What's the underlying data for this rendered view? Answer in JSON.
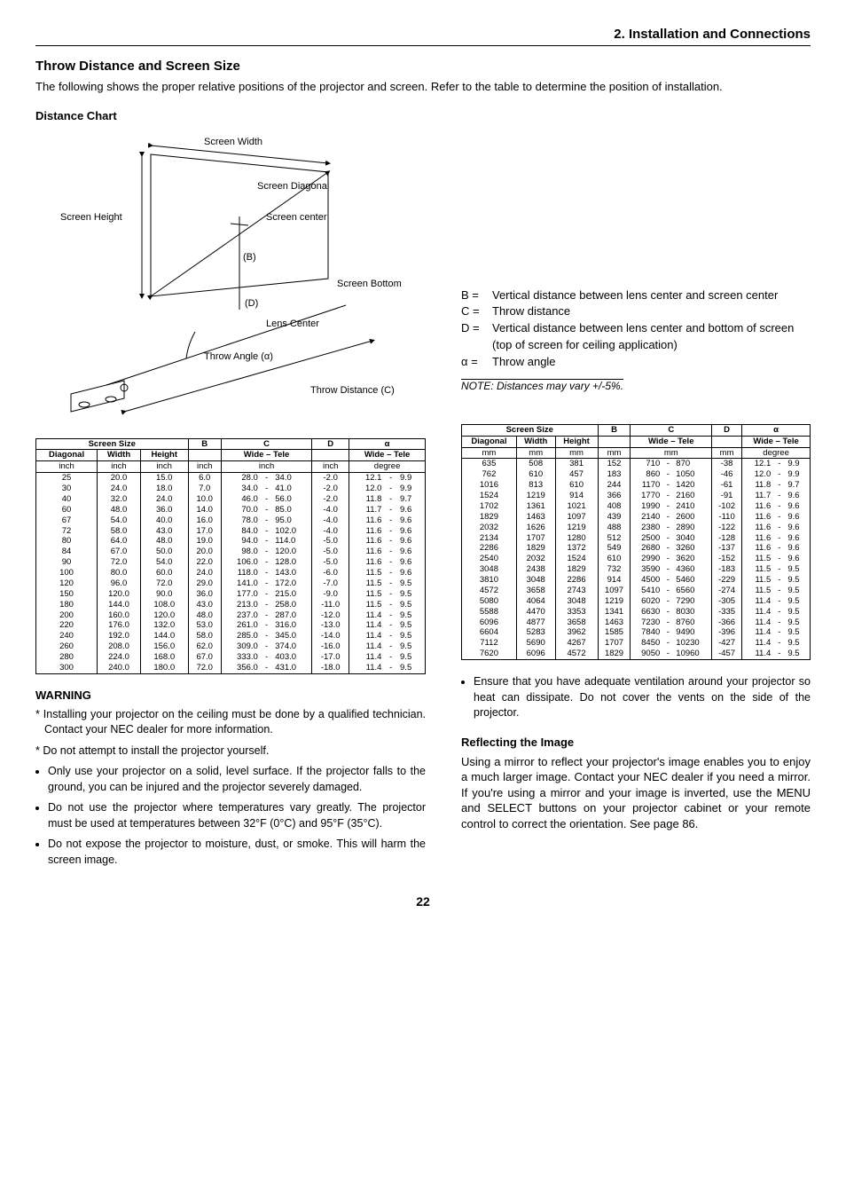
{
  "section_header": "2. Installation and Connections",
  "title": "Throw Distance and Screen Size",
  "intro": "The following shows the proper relative positions of the projector and screen. Refer to the table to determine the position of installation.",
  "distance_chart_title": "Distance Chart",
  "diagram": {
    "screen_width": "Screen Width",
    "screen_height": "Screen Height",
    "screen_diagonal": "Screen Diagonal",
    "screen_center": "Screen center",
    "screen_bottom": "Screen Bottom",
    "lens_center": "Lens Center",
    "throw_angle": "Throw Angle (α)",
    "throw_distance": "Throw Distance (C)",
    "b": "(B)",
    "d": "(D)"
  },
  "definitions": {
    "b_key": "B =",
    "b_val": "Vertical distance between lens center and screen center",
    "c_key": "C =",
    "c_val": "Throw distance",
    "d_key": "D =",
    "d_val": "Vertical distance between lens center and bottom of screen (top of screen for ceiling application)",
    "alpha_key": "α =",
    "alpha_val": "Throw angle"
  },
  "note": "NOTE: Distances may vary +/-5%.",
  "table_inch": {
    "headers": {
      "ss": "Screen Size",
      "diag": "Diagonal",
      "w": "Width",
      "h": "Height",
      "b": "B",
      "c": "C",
      "wt": "Wide – Tele",
      "d": "D",
      "a": "α"
    },
    "unit": "inch",
    "unit_deg": "degree",
    "rows": [
      [
        "25",
        "20.0",
        "15.0",
        "6.0",
        "28.0",
        "-",
        "34.0",
        "-2.0",
        "12.1",
        "-",
        "9.9"
      ],
      [
        "30",
        "24.0",
        "18.0",
        "7.0",
        "34.0",
        "-",
        "41.0",
        "-2.0",
        "12.0",
        "-",
        "9.9"
      ],
      [
        "40",
        "32.0",
        "24.0",
        "10.0",
        "46.0",
        "-",
        "56.0",
        "-2.0",
        "11.8",
        "-",
        "9.7"
      ],
      [
        "60",
        "48.0",
        "36.0",
        "14.0",
        "70.0",
        "-",
        "85.0",
        "-4.0",
        "11.7",
        "-",
        "9.6"
      ],
      [
        "67",
        "54.0",
        "40.0",
        "16.0",
        "78.0",
        "-",
        "95.0",
        "-4.0",
        "11.6",
        "-",
        "9.6"
      ],
      [
        "72",
        "58.0",
        "43.0",
        "17.0",
        "84.0",
        "-",
        "102.0",
        "-4.0",
        "11.6",
        "-",
        "9.6"
      ],
      [
        "80",
        "64.0",
        "48.0",
        "19.0",
        "94.0",
        "-",
        "114.0",
        "-5.0",
        "11.6",
        "-",
        "9.6"
      ],
      [
        "84",
        "67.0",
        "50.0",
        "20.0",
        "98.0",
        "-",
        "120.0",
        "-5.0",
        "11.6",
        "-",
        "9.6"
      ],
      [
        "90",
        "72.0",
        "54.0",
        "22.0",
        "106.0",
        "-",
        "128.0",
        "-5.0",
        "11.6",
        "-",
        "9.6"
      ],
      [
        "100",
        "80.0",
        "60.0",
        "24.0",
        "118.0",
        "-",
        "143.0",
        "-6.0",
        "11.5",
        "-",
        "9.6"
      ],
      [
        "120",
        "96.0",
        "72.0",
        "29.0",
        "141.0",
        "-",
        "172.0",
        "-7.0",
        "11.5",
        "-",
        "9.5"
      ],
      [
        "150",
        "120.0",
        "90.0",
        "36.0",
        "177.0",
        "-",
        "215.0",
        "-9.0",
        "11.5",
        "-",
        "9.5"
      ],
      [
        "180",
        "144.0",
        "108.0",
        "43.0",
        "213.0",
        "-",
        "258.0",
        "-11.0",
        "11.5",
        "-",
        "9.5"
      ],
      [
        "200",
        "160.0",
        "120.0",
        "48.0",
        "237.0",
        "-",
        "287.0",
        "-12.0",
        "11.4",
        "-",
        "9.5"
      ],
      [
        "220",
        "176.0",
        "132.0",
        "53.0",
        "261.0",
        "-",
        "316.0",
        "-13.0",
        "11.4",
        "-",
        "9.5"
      ],
      [
        "240",
        "192.0",
        "144.0",
        "58.0",
        "285.0",
        "-",
        "345.0",
        "-14.0",
        "11.4",
        "-",
        "9.5"
      ],
      [
        "260",
        "208.0",
        "156.0",
        "62.0",
        "309.0",
        "-",
        "374.0",
        "-16.0",
        "11.4",
        "-",
        "9.5"
      ],
      [
        "280",
        "224.0",
        "168.0",
        "67.0",
        "333.0",
        "-",
        "403.0",
        "-17.0",
        "11.4",
        "-",
        "9.5"
      ],
      [
        "300",
        "240.0",
        "180.0",
        "72.0",
        "356.0",
        "-",
        "431.0",
        "-18.0",
        "11.4",
        "-",
        "9.5"
      ]
    ]
  },
  "table_mm": {
    "unit": "mm",
    "unit_deg": "degree",
    "rows": [
      [
        "635",
        "508",
        "381",
        "152",
        "710",
        "-",
        "870",
        "-38",
        "12.1",
        "-",
        "9.9"
      ],
      [
        "762",
        "610",
        "457",
        "183",
        "860",
        "-",
        "1050",
        "-46",
        "12.0",
        "-",
        "9.9"
      ],
      [
        "1016",
        "813",
        "610",
        "244",
        "1170",
        "-",
        "1420",
        "-61",
        "11.8",
        "-",
        "9.7"
      ],
      [
        "1524",
        "1219",
        "914",
        "366",
        "1770",
        "-",
        "2160",
        "-91",
        "11.7",
        "-",
        "9.6"
      ],
      [
        "1702",
        "1361",
        "1021",
        "408",
        "1990",
        "-",
        "2410",
        "-102",
        "11.6",
        "-",
        "9.6"
      ],
      [
        "1829",
        "1463",
        "1097",
        "439",
        "2140",
        "-",
        "2600",
        "-110",
        "11.6",
        "-",
        "9.6"
      ],
      [
        "2032",
        "1626",
        "1219",
        "488",
        "2380",
        "-",
        "2890",
        "-122",
        "11.6",
        "-",
        "9.6"
      ],
      [
        "2134",
        "1707",
        "1280",
        "512",
        "2500",
        "-",
        "3040",
        "-128",
        "11.6",
        "-",
        "9.6"
      ],
      [
        "2286",
        "1829",
        "1372",
        "549",
        "2680",
        "-",
        "3260",
        "-137",
        "11.6",
        "-",
        "9.6"
      ],
      [
        "2540",
        "2032",
        "1524",
        "610",
        "2990",
        "-",
        "3620",
        "-152",
        "11.5",
        "-",
        "9.6"
      ],
      [
        "3048",
        "2438",
        "1829",
        "732",
        "3590",
        "-",
        "4360",
        "-183",
        "11.5",
        "-",
        "9.5"
      ],
      [
        "3810",
        "3048",
        "2286",
        "914",
        "4500",
        "-",
        "5460",
        "-229",
        "11.5",
        "-",
        "9.5"
      ],
      [
        "4572",
        "3658",
        "2743",
        "1097",
        "5410",
        "-",
        "6560",
        "-274",
        "11.5",
        "-",
        "9.5"
      ],
      [
        "5080",
        "4064",
        "3048",
        "1219",
        "6020",
        "-",
        "7290",
        "-305",
        "11.4",
        "-",
        "9.5"
      ],
      [
        "5588",
        "4470",
        "3353",
        "1341",
        "6630",
        "-",
        "8030",
        "-335",
        "11.4",
        "-",
        "9.5"
      ],
      [
        "6096",
        "4877",
        "3658",
        "1463",
        "7230",
        "-",
        "8760",
        "-366",
        "11.4",
        "-",
        "9.5"
      ],
      [
        "6604",
        "5283",
        "3962",
        "1585",
        "7840",
        "-",
        "9490",
        "-396",
        "11.4",
        "-",
        "9.5"
      ],
      [
        "7112",
        "5690",
        "4267",
        "1707",
        "8450",
        "-",
        "10230",
        "-427",
        "11.4",
        "-",
        "9.5"
      ],
      [
        "7620",
        "6096",
        "4572",
        "1829",
        "9050",
        "-",
        "10960",
        "-457",
        "11.4",
        "-",
        "9.5"
      ]
    ]
  },
  "warning_title": "WARNING",
  "warning_star": [
    "Installing your projector on the ceiling must be done by a qualified technician. Contact your NEC dealer for more information.",
    "Do not attempt to install the projector yourself."
  ],
  "warning_items": [
    "Only use your projector on a solid, level surface. If the projector falls to the ground, you can be injured and the projector severely damaged.",
    "Do not use the projector where temperatures vary greatly. The projector must be used at temperatures between 32°F (0°C) and 95°F (35°C).",
    "Do not expose the projector to moisture, dust, or smoke. This will harm the screen image."
  ],
  "right_items": [
    "Ensure that you have adequate ventilation around your projector so heat can dissipate. Do not cover the vents on the side of the projector."
  ],
  "reflect_title": "Reflecting the Image",
  "reflect_text": "Using a mirror to reflect your projector's image enables you to enjoy a much larger image. Contact your NEC dealer if you need a mirror. If you're using a mirror and your image is inverted, use the MENU and SELECT buttons on your projector cabinet or your remote control to correct the orientation. See page 86.",
  "page_number": "22"
}
